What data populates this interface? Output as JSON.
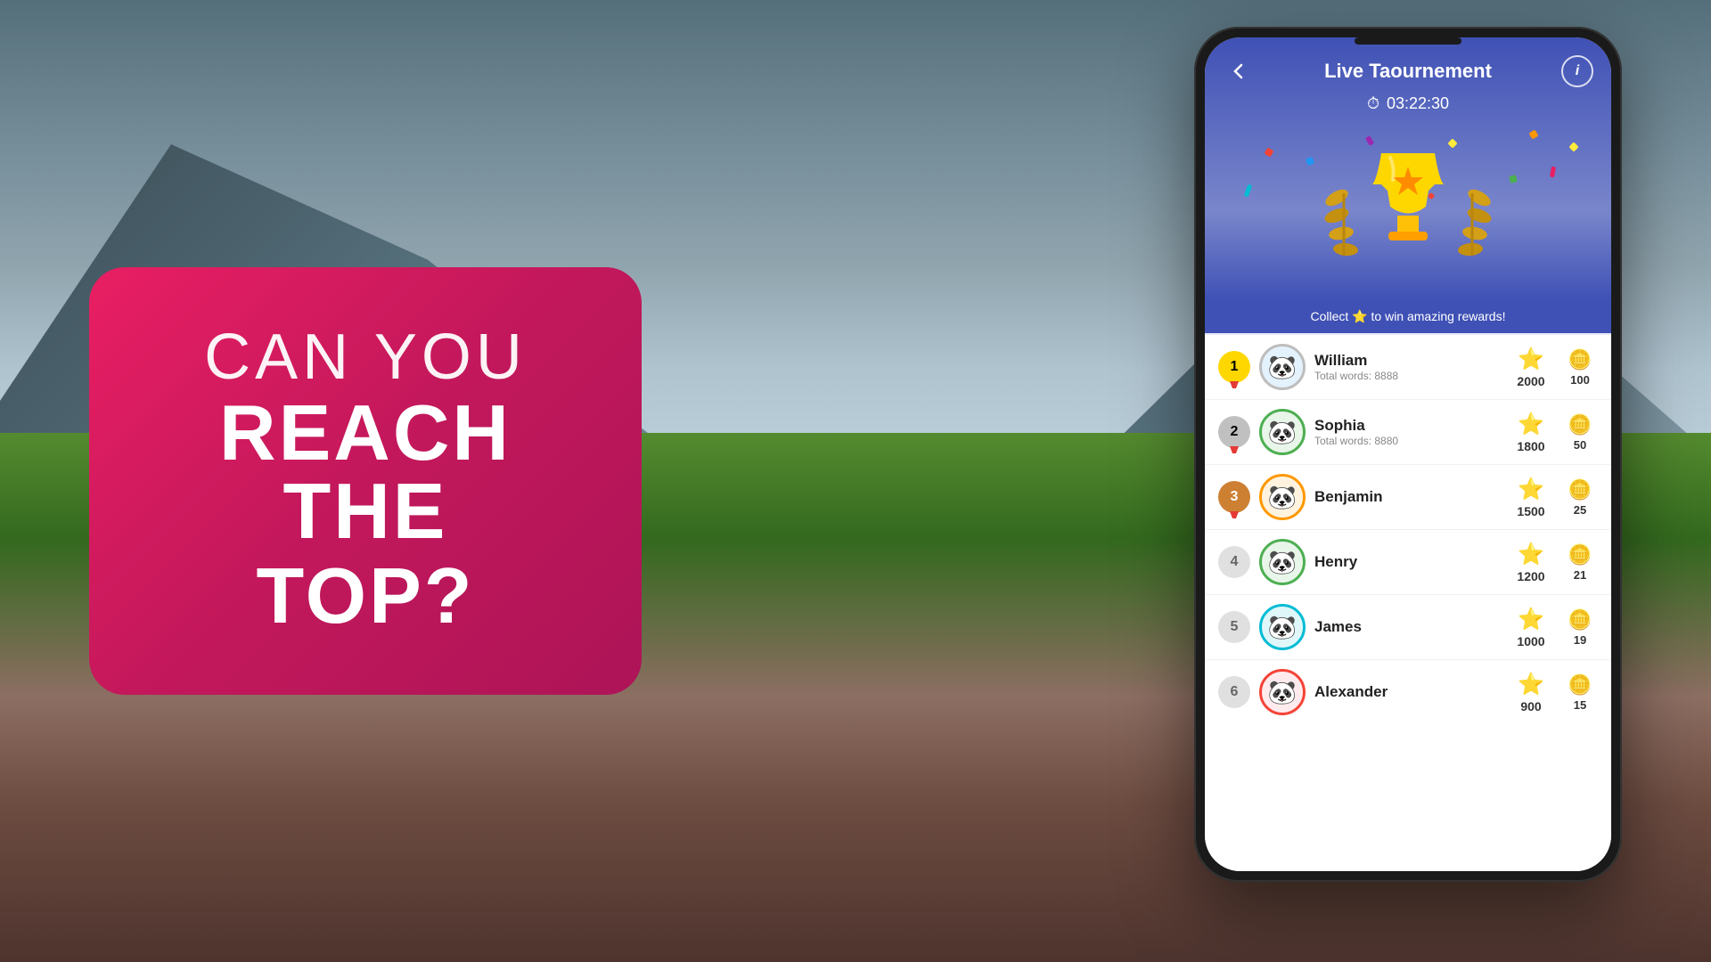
{
  "background": {
    "description": "Tulip field with mountains and cloudy sky"
  },
  "promo": {
    "line1": "CAN YOU",
    "line2": "REACH THE",
    "line3": "TOP?"
  },
  "app": {
    "title": "Live Taournement",
    "back_label": "←",
    "info_label": "i",
    "timer": "03:22:30",
    "timer_icon": "⏱",
    "collect_bar": "Collect ⭐ to win amazing rewards!",
    "leaderboard": [
      {
        "rank": 1,
        "name": "William",
        "words": "Total words: 8888",
        "score": 2000,
        "coins": 100,
        "avatar": "🐼"
      },
      {
        "rank": 2,
        "name": "Sophia",
        "words": "Total words: 8880",
        "score": 1800,
        "coins": 50,
        "avatar": "🐼"
      },
      {
        "rank": 3,
        "name": "Benjamin",
        "words": "",
        "score": 1500,
        "coins": 25,
        "avatar": "🐼"
      },
      {
        "rank": 4,
        "name": "Henry",
        "words": "",
        "score": 1200,
        "coins": 21,
        "avatar": "🐼"
      },
      {
        "rank": 5,
        "name": "James",
        "words": "",
        "score": 1000,
        "coins": 19,
        "avatar": "🐼"
      },
      {
        "rank": 6,
        "name": "Alexander",
        "words": "",
        "score": 900,
        "coins": 15,
        "avatar": "🐼"
      }
    ]
  }
}
